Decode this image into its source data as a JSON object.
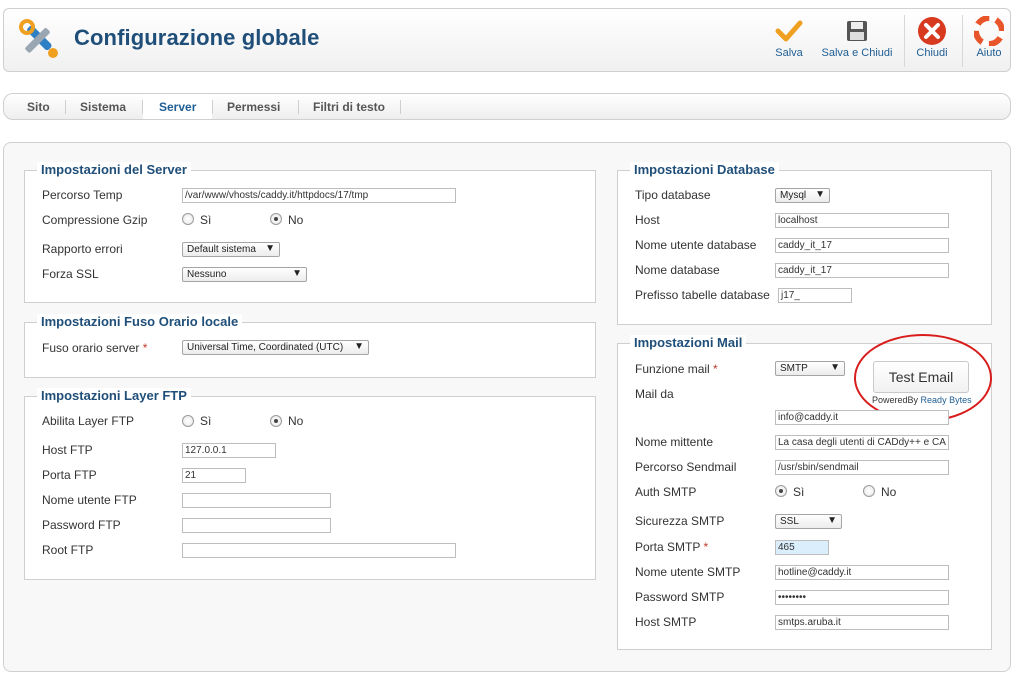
{
  "header": {
    "title": "Configurazione globale",
    "toolbar": [
      {
        "label": "Salva",
        "icon": "check-icon"
      },
      {
        "label": "Salva e Chiudi",
        "icon": "save-icon"
      },
      {
        "label": "Chiudi",
        "icon": "close-icon"
      },
      {
        "label": "Aiuto",
        "icon": "help-icon"
      }
    ]
  },
  "tabs": [
    {
      "label": "Sito"
    },
    {
      "label": "Sistema"
    },
    {
      "label": "Server",
      "active": true
    },
    {
      "label": "Permessi"
    },
    {
      "label": "Filtri di testo"
    }
  ],
  "server": {
    "legend": "Impostazioni del Server",
    "temp_label": "Percorso Temp",
    "temp_value": "/var/www/vhosts/caddy.it/httpdocs/17/tmp",
    "gzip_label": "Compressione Gzip",
    "gzip_yes": "Sì",
    "gzip_no": "No",
    "gzip_selected": "No",
    "errors_label": "Rapporto errori",
    "errors_value": "Default sistema",
    "ssl_label": "Forza SSL",
    "ssl_value": "Nessuno"
  },
  "timezone": {
    "legend": "Impostazioni Fuso Orario locale",
    "label": "Fuso orario server",
    "required": "*",
    "value": "Universal Time, Coordinated (UTC)"
  },
  "ftp": {
    "legend": "Impostazioni Layer FTP",
    "enable_label": "Abilita Layer FTP",
    "enable_yes": "Sì",
    "enable_no": "No",
    "enable_selected": "No",
    "host_label": "Host FTP",
    "host_value": "127.0.0.1",
    "port_label": "Porta FTP",
    "port_value": "21",
    "user_label": "Nome utente FTP",
    "user_value": "",
    "password_label": "Password FTP",
    "password_value": "",
    "root_label": "Root FTP",
    "root_value": ""
  },
  "database": {
    "legend": "Impostazioni Database",
    "type_label": "Tipo database",
    "type_value": "Mysql",
    "host_label": "Host",
    "host_value": "localhost",
    "user_label": "Nome utente database",
    "user_value": "caddy_it_17",
    "name_label": "Nome database",
    "name_value": "caddy_it_17",
    "prefix_label": "Prefisso tabelle database",
    "prefix_value": "j17_"
  },
  "mail": {
    "legend": "Impostazioni Mail",
    "function_label": "Funzione mail",
    "required": "*",
    "function_value": "SMTP",
    "test_button": "Test Email",
    "powered_by": "PoweredBy",
    "powered_brand": "Ready Bytes",
    "from_label": "Mail da",
    "from_value": "info@caddy.it",
    "sender_label": "Nome mittente",
    "sender_value": "La casa degli utenti di CADdy++ e CA",
    "sendmail_label": "Percorso Sendmail",
    "sendmail_value": "/usr/sbin/sendmail",
    "auth_label": "Auth SMTP",
    "auth_yes": "Sì",
    "auth_no": "No",
    "auth_selected": "Sì",
    "security_label": "Sicurezza SMTP",
    "security_value": "SSL",
    "port_label": "Porta SMTP",
    "port_value": "465",
    "user_label": "Nome utente SMTP",
    "user_value": "hotline@caddy.it",
    "password_label": "Password SMTP",
    "password_value": "••••••••",
    "host_label": "Host SMTP",
    "host_value": "smtps.aruba.it"
  },
  "colors": {
    "title": "#1f4e79",
    "link": "#1f5e94",
    "required": "#c0392b",
    "highlight_ellipse": "#d91c1c"
  }
}
